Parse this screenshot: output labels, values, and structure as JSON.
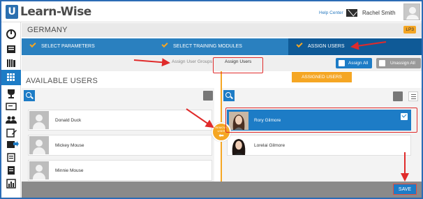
{
  "app": {
    "logo_mark": "U",
    "logo_text": "Learn-Wise",
    "help_center": "Help Center",
    "user_name": "Rachel Smith"
  },
  "sidebar": {
    "icons": [
      "dashboard-icon",
      "document-icon",
      "library-icon",
      "grid-icon",
      "trophy-icon",
      "presentation-icon",
      "users-icon",
      "edit-icon",
      "export-icon",
      "report-icon",
      "clipboard-icon",
      "chart-icon"
    ]
  },
  "header": {
    "title": "GERMANY",
    "badge": "LP3"
  },
  "steps": [
    {
      "label": "SELECT PARAMETERS"
    },
    {
      "label": "SELECT TRAINING MODULES"
    },
    {
      "label": "ASSIGN USERS"
    }
  ],
  "tabs": {
    "assign_user_groups": "Assign User Groups",
    "assign_users": "Assign Users"
  },
  "actions": {
    "assign_all": "Assign All",
    "unassign_all": "Unassign All",
    "save": "SAVE"
  },
  "available": {
    "title": "AVAILABLE USERS",
    "users": [
      "Donald Duck",
      "Mickey Mouse",
      "Minnie Mouse"
    ]
  },
  "assigned": {
    "title": "ASSIGNED USERS",
    "users": [
      "Rory Gilmore",
      "Lorelai Gilmore"
    ]
  },
  "move_button": {
    "line1": "REMOVE",
    "line2": "USER"
  },
  "colors": {
    "brand_blue": "#1d7cc6",
    "step_bar": "#2a80bf",
    "accent_orange": "#f5a623",
    "annotation_red": "#e02b2b"
  }
}
